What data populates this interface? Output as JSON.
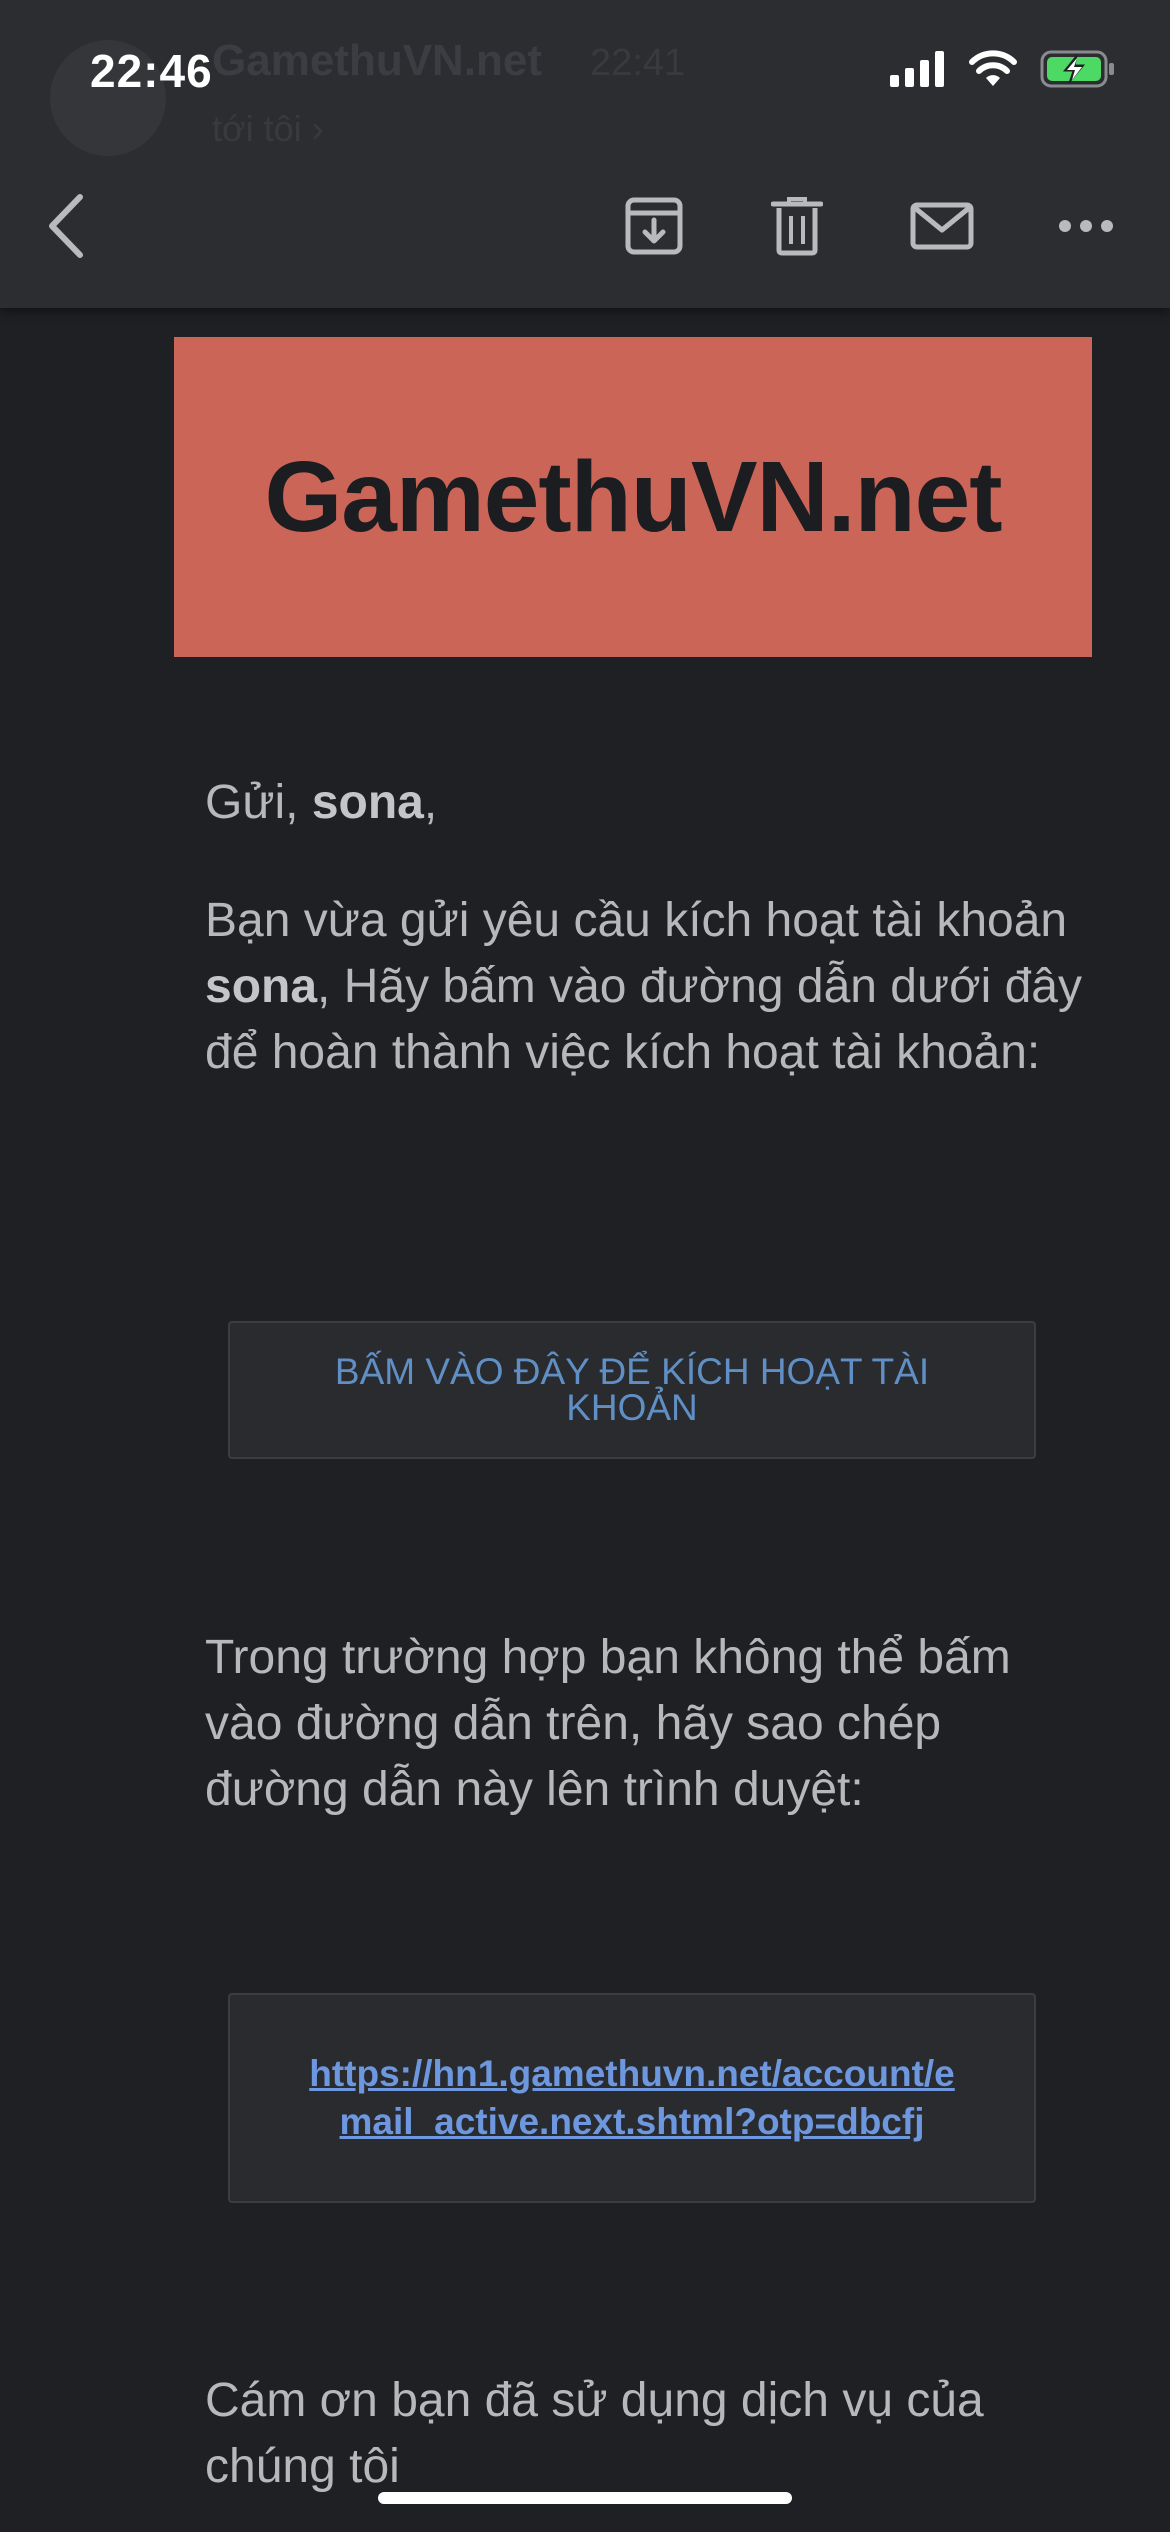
{
  "status_bar": {
    "time": "22:46"
  },
  "header_ghost": {
    "sender": "GamethuVN.net",
    "time": "22:41",
    "to": "tới tôi ›"
  },
  "toolbar": {
    "back_icon": "chevron-left-icon",
    "archive_icon": "archive-icon",
    "delete_icon": "trash-icon",
    "mark_unread_icon": "mail-icon",
    "more_icon": "more-horizontal-icon"
  },
  "email": {
    "banner_title": "GamethuVN.net",
    "greeting_prefix": "Gửi, ",
    "greeting_name": "sona",
    "greeting_suffix": ",",
    "para1_a": "Bạn vừa gửi yêu cầu kích hoạt tài khoản ",
    "para1_name": "sona",
    "para1_b": ", Hãy bấm vào đường dẫn dưới đây để hoàn thành việc kích hoạt tài khoản:",
    "activate_button": "BẤM VÀO ĐÂY ĐỂ KÍCH HOẠT TÀI KHOẢN",
    "para2": "Trong trường hợp bạn không thể bấm vào đường dẫn trên, hãy sao chép đường dẫn này lên trình duyệt:",
    "link": "https://hn1.gamethuvn.net/account/email_active.next.shtml?otp=dbcfj",
    "closing": "Cám ơn bạn đã sử dụng dịch vụ của chúng tôi"
  },
  "colors": {
    "background": "#1f2024",
    "topbar": "#2c2d31",
    "banner": "#cb6557",
    "link": "#6d98e0",
    "battery": "#4cd964"
  }
}
